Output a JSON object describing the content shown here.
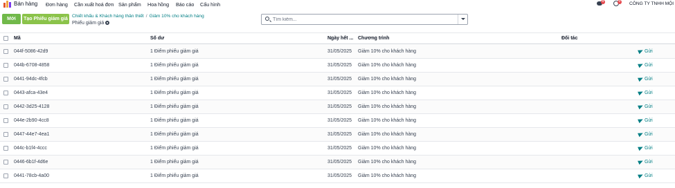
{
  "app": {
    "name": "Bán hàng"
  },
  "menu": [
    "Đơn hàng",
    "Cần xuất hoá đơn",
    "Sản phẩm",
    "Hoa hồng",
    "Báo cáo",
    "Cấu hình"
  ],
  "systray": {
    "chat_count": "8",
    "activity_count": "2",
    "company": "CÔNG TY TNHH MỘI"
  },
  "toolbar": {
    "new_label": "Mới",
    "generate_label": "Tạo Phiếu giảm giá"
  },
  "breadcrumb": {
    "parent": "Chiết khấu & Khách hàng thân thiết",
    "separator": "/",
    "current": "Giảm 10% cho khách hàng"
  },
  "page": {
    "title": "Phiếu giảm giá"
  },
  "search": {
    "placeholder": "Tìm kiếm..."
  },
  "table": {
    "columns": {
      "code": "Mã",
      "balance": "Số dư",
      "expiry": "Ngày hết ...",
      "program": "Chương trình",
      "partner": "Đối tác"
    },
    "send_label": "Gửi",
    "rows": [
      {
        "code": "044f-5086-42d9",
        "balance": "1 Điểm phiếu giảm giá",
        "expiry": "31/05/2025",
        "program": "Giảm 10% cho khách hàng"
      },
      {
        "code": "044b-6708-4858",
        "balance": "1 Điểm phiếu giảm giá",
        "expiry": "31/05/2025",
        "program": "Giảm 10% cho khách hàng"
      },
      {
        "code": "0441-94dc-4fcb",
        "balance": "1 Điểm phiếu giảm giá",
        "expiry": "31/05/2025",
        "program": "Giảm 10% cho khách hàng"
      },
      {
        "code": "0443-afca-43e4",
        "balance": "1 Điểm phiếu giảm giá",
        "expiry": "31/05/2025",
        "program": "Giảm 10% cho khách hàng"
      },
      {
        "code": "0442-3d25-4128",
        "balance": "1 Điểm phiếu giảm giá",
        "expiry": "31/05/2025",
        "program": "Giảm 10% cho khách hàng"
      },
      {
        "code": "044e-2b90-4cc8",
        "balance": "1 Điểm phiếu giảm giá",
        "expiry": "31/05/2025",
        "program": "Giảm 10% cho khách hàng"
      },
      {
        "code": "0447-44e7-4ea1",
        "balance": "1 Điểm phiếu giảm giá",
        "expiry": "31/05/2025",
        "program": "Giảm 10% cho khách hàng"
      },
      {
        "code": "044c-b1f4-4ccc",
        "balance": "1 Điểm phiếu giảm giá",
        "expiry": "31/05/2025",
        "program": "Giảm 10% cho khách hàng"
      },
      {
        "code": "0446-6b1f-4d6e",
        "balance": "1 Điểm phiếu giảm giá",
        "expiry": "31/05/2025",
        "program": "Giảm 10% cho khách hàng"
      },
      {
        "code": "0441-78cb-4a00",
        "balance": "1 Điểm phiếu giảm giá",
        "expiry": "31/05/2025",
        "program": "Giảm 10% cho khách hàng"
      }
    ]
  },
  "colors": {
    "primary": "#8bc34a",
    "link": "#017e84",
    "badge": "#e5484d"
  }
}
